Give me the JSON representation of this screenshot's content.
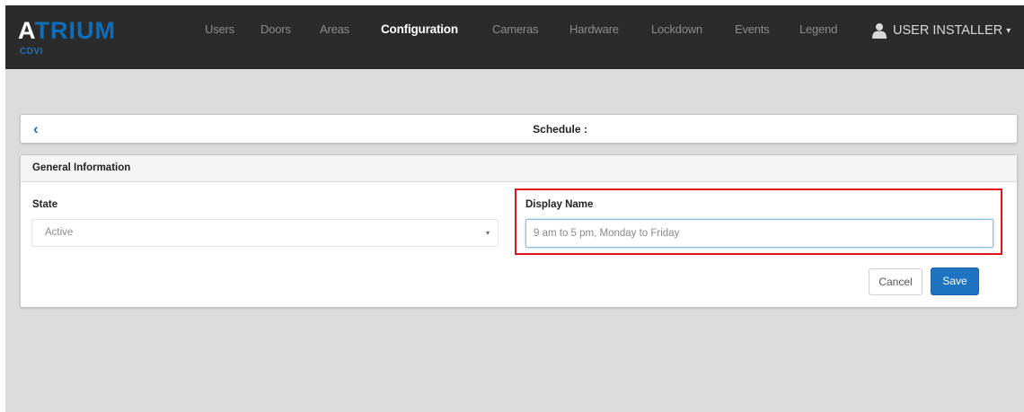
{
  "brand": {
    "logo_text_first": "A",
    "logo_text_rest": "TRIUM",
    "sub_text": "CDVI"
  },
  "nav": {
    "items": [
      {
        "label": "Users",
        "active": false
      },
      {
        "label": "Doors",
        "active": false
      },
      {
        "label": "Areas",
        "active": false
      },
      {
        "label": "Configuration",
        "active": true
      },
      {
        "label": "Cameras",
        "active": false
      },
      {
        "label": "Hardware",
        "active": false
      },
      {
        "label": "Lockdown",
        "active": false
      },
      {
        "label": "Events",
        "active": false
      },
      {
        "label": "Legend",
        "active": false
      }
    ],
    "user": {
      "label": "USER INSTALLER",
      "icon": "user-icon",
      "caret_icon": "caret-down-icon"
    }
  },
  "header": {
    "back_icon": "chevron-left-icon",
    "back_glyph": "‹",
    "title": "Schedule :"
  },
  "form": {
    "heading": "General Information",
    "state": {
      "label": "State",
      "value": "Active",
      "arrow_glyph": "▾"
    },
    "display_name": {
      "label": "Display Name",
      "value": "9 am to 5 pm, Monday to Friday"
    },
    "cancel_label": "Cancel",
    "save_label": "Save"
  },
  "colors": {
    "navbar": "#2b2b2b",
    "accent": "#1f74c2",
    "highlight": "#e0131b",
    "page_background": "#dcdcdc"
  }
}
